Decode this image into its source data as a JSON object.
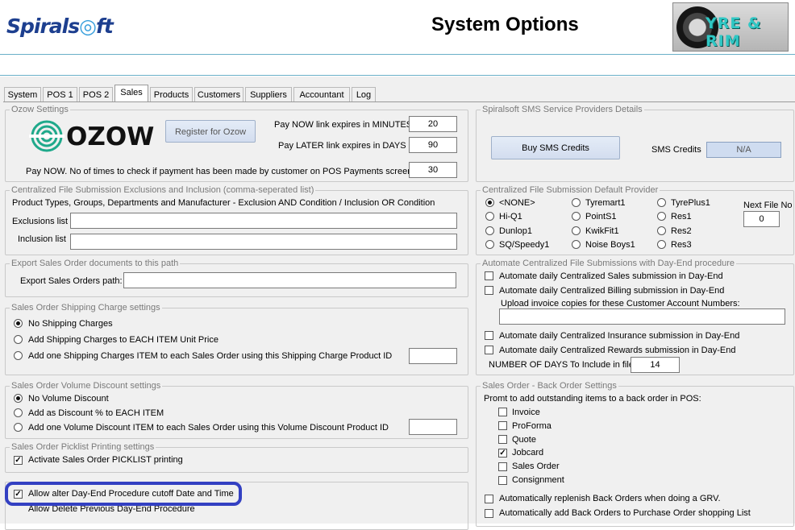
{
  "header": {
    "logo_left": "Spirals",
    "logo_right": "ft",
    "title": "System Options",
    "brand_text": "YRE & RIM"
  },
  "tabs": [
    "System",
    "POS 1",
    "POS 2",
    "Sales",
    "Products",
    "Customers",
    "Suppliers",
    "Accountant",
    "Log"
  ],
  "active_tab": "Sales",
  "ozow": {
    "legend": "Ozow Settings",
    "logo_text": "OZOW",
    "register_label": "Register for Ozow",
    "pay_now_label": "Pay NOW link expires in MINUTES",
    "pay_now_value": "20",
    "pay_later_label": "Pay LATER link expires in DAYS",
    "pay_later_value": "90",
    "checks_label": "Pay NOW. No of times to check if payment has been made by customer on POS Payments screen",
    "checks_value": "30"
  },
  "cfs": {
    "legend": "Centralized File Submission Exclusions and Inclusion (comma-seperated list)",
    "desc": "Product Types, Groups, Departments and Manufacturer - Exclusion AND Condition / Inclusion OR Condition",
    "exclusions_label": "Exclusions list",
    "exclusions_value": "",
    "inclusion_label": "Inclusion list",
    "inclusion_value": ""
  },
  "export": {
    "legend": "Export Sales Order documents to this path",
    "path_label": "Export Sales Orders path:",
    "path_value": ""
  },
  "shipping": {
    "legend": "Sales Order Shipping Charge settings",
    "options": [
      "No Shipping Charges",
      "Add Shipping Charges to EACH ITEM Unit Price",
      "Add one Shipping Charges ITEM to each Sales Order using this Shipping Charge Product ID"
    ],
    "selected": 0,
    "product_id": ""
  },
  "volume": {
    "legend": "Sales Order Volume Discount settings",
    "options": [
      "No Volume Discount",
      "Add as Discount % to EACH ITEM",
      "Add one Volume Discount ITEM to each Sales Order using this Volume Discount Product ID"
    ],
    "selected": 0,
    "product_id": ""
  },
  "picklist": {
    "legend": "Sales Order Picklist Printing settings",
    "activate_label": "Activate Sales Order PICKLIST printing",
    "activate_checked": true
  },
  "dayend": {
    "allow_alter_label": "Allow alter Day-End Procedure cutoff Date and Time",
    "allow_alter_checked": true,
    "allow_delete_label": "Allow Delete Previous Day-End Procedure"
  },
  "sms": {
    "legend": "Spiralsoft SMS Service Providers Details",
    "buy_label": "Buy SMS Credits",
    "credits_label": "SMS Credits",
    "credits_value": "N/A"
  },
  "provider": {
    "legend": "Centralized File Submission Default Provider",
    "columns": [
      [
        "<NONE>",
        "Hi-Q1",
        "Dunlop1",
        "SQ/Speedy1"
      ],
      [
        "Tyremart1",
        "PointS1",
        "KwikFit1",
        "Noise Boys1"
      ],
      [
        "TyrePlus1",
        "Res1",
        "Res2",
        "Res3"
      ]
    ],
    "selected": "<NONE>",
    "next_file_label": "Next File No",
    "next_file_value": "0"
  },
  "automate": {
    "legend": "Automate Centralized File Submissions with Day-End procedure",
    "sales_label": "Automate daily Centralized Sales submission in Day-End",
    "billing_label": "Automate daily Centralized Billing submission in Day-End",
    "upload_label": "Upload invoice copies for these Customer Account Numbers:",
    "upload_value": "",
    "insurance_label": "Automate daily Centralized Insurance submission in Day-End",
    "rewards_label": "Automate daily Centralized Rewards submission in Day-End",
    "days_label": "NUMBER OF DAYS To Include in file",
    "days_value": "14"
  },
  "backorder": {
    "legend": "Sales Order - Back Order Settings",
    "prompt_label": "Promt to add outstanding items to a back order in POS:",
    "items": [
      {
        "label": "Invoice",
        "checked": false
      },
      {
        "label": "ProForma",
        "checked": false
      },
      {
        "label": "Quote",
        "checked": false
      },
      {
        "label": "Jobcard",
        "checked": true
      },
      {
        "label": "Sales Order",
        "checked": false
      },
      {
        "label": "Consignment",
        "checked": false
      }
    ],
    "replenish_label": "Automatically replenish Back Orders when doing a GRV.",
    "add_po_label": "Automatically add Back Orders to Purchase Order shopping List"
  },
  "colors": {
    "logo_blue": "#1d3f8f",
    "highlight": "#3340c2",
    "sms_box": "#cfdcf0",
    "brand_teal": "#2fc7c4"
  }
}
